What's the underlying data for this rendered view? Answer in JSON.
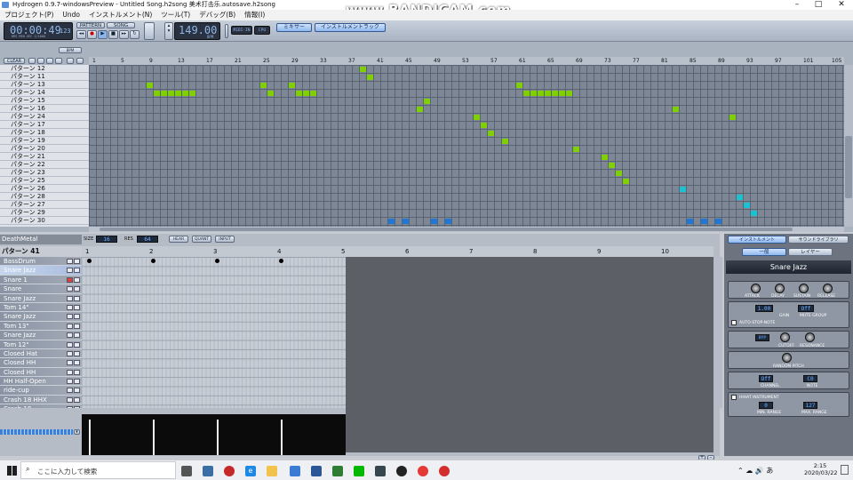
{
  "window": {
    "title": "Hydrogen 0.9.7-windowsPreview - Untitled Song.h2song 美术打击乐.autosave.h2song",
    "watermark": "www.BANDICAM.com"
  },
  "menu": [
    "プロジェクト(P)",
    "Undo",
    "インストルメント(N)",
    "ツール(T)",
    "デバッグ(B)",
    "情報(I)"
  ],
  "transport": {
    "time": "00:00:49",
    "time_ms": "123",
    "time_labels": "HRS   MIN   SEC  1/1000",
    "bpm": "149.00",
    "bpm_label": "BPM",
    "mode_pattern": "PATTERN",
    "mode_song": "SONG",
    "midi_in": "MIDI-IN",
    "cpu": "CPU",
    "mixer_btn": "ミキサー",
    "instrument_rack_btn": "インストルメントラック"
  },
  "song_editor": {
    "bpm_button": "BPM",
    "clear_button": "CLEAR",
    "ruler": [
      "1",
      "5",
      "9",
      "13",
      "17",
      "21",
      "25",
      "29",
      "33",
      "37",
      "41",
      "45",
      "49",
      "53",
      "57",
      "61",
      "65",
      "69",
      "73",
      "77",
      "81",
      "85",
      "89",
      "93",
      "97",
      "101",
      "105"
    ],
    "patterns": [
      "パターン 12",
      "パターン 11",
      "パターン 13",
      "パターン 14",
      "パターン 15",
      "パターン 16",
      "パターン 24",
      "パターン 17",
      "パターン 18",
      "パターン 19",
      "パターン 20",
      "パターン 21",
      "パターン 22",
      "パターン 23",
      "パターン 25",
      "パターン 26",
      "パターン 28",
      "パターン 27",
      "パターン 29",
      "パターン 30"
    ]
  },
  "pattern_editor": {
    "drumkit": "DeathMetal",
    "pattern_name": "パターン 41",
    "size_label": "SIZE",
    "size_value": "16",
    "res_label": "RES",
    "res_value": "64",
    "hear_label": "HEAR",
    "quant_label": "QUANT",
    "input_label": "INPUT",
    "ruler": [
      "1",
      "2",
      "3",
      "4",
      "5",
      "6",
      "7",
      "8",
      "9",
      "10"
    ],
    "instruments": [
      "BassDrum",
      "Snare Jazz",
      "Snare 1",
      "Snare",
      "Snare Jazz",
      "Tom 14\"",
      "Snare Jazz",
      "Tom 13\"",
      "Snare Jazz",
      "Tom 12\"",
      "Closed Hat",
      "Closed HH",
      "Closed HH",
      "HH Half-Open",
      "ride-cup",
      "Crash 18 HHX",
      "Crash 18"
    ]
  },
  "instrument_panel": {
    "tab_instrument": "インストルメント",
    "tab_sound_library": "サウンドライブラリ",
    "sub_general": "一般",
    "sub_layer": "レイヤー",
    "name": "Snare Jazz",
    "adsr": [
      "ATTACK",
      "DECAY",
      "SUSTAIN",
      "RELEASE"
    ],
    "gain_value": "1.00",
    "gain_label": "GAIN",
    "mute_group_value": "Off",
    "mute_group_label": "MUTE GROUP",
    "auto_stop_note": "AUTO-STOP-NOTE",
    "filter_byp": "BYP",
    "cutoff": "CUTOFF",
    "resonance": "RESONANCE",
    "random_pitch": "RANDOM PITCH",
    "channel_value": "Off",
    "channel_label": "CHANNEL",
    "note_value": "C0",
    "note_label": "NOTE",
    "hihat_label": "HIHAT INSTRUMENT",
    "min_range_value": "0",
    "min_range_label": "MIN. RANGE",
    "max_range_value": "127",
    "max_range_label": "MAX. RANGE"
  },
  "taskbar": {
    "search_placeholder": "ここに入力して検索",
    "time": "2:15",
    "date": "2020/03/22"
  },
  "colors": {
    "green_cell": "#80d000",
    "cyan_cell": "#19c3d1",
    "blue_cell": "#1f77d6",
    "lcd_text": "#8fb8e8"
  }
}
